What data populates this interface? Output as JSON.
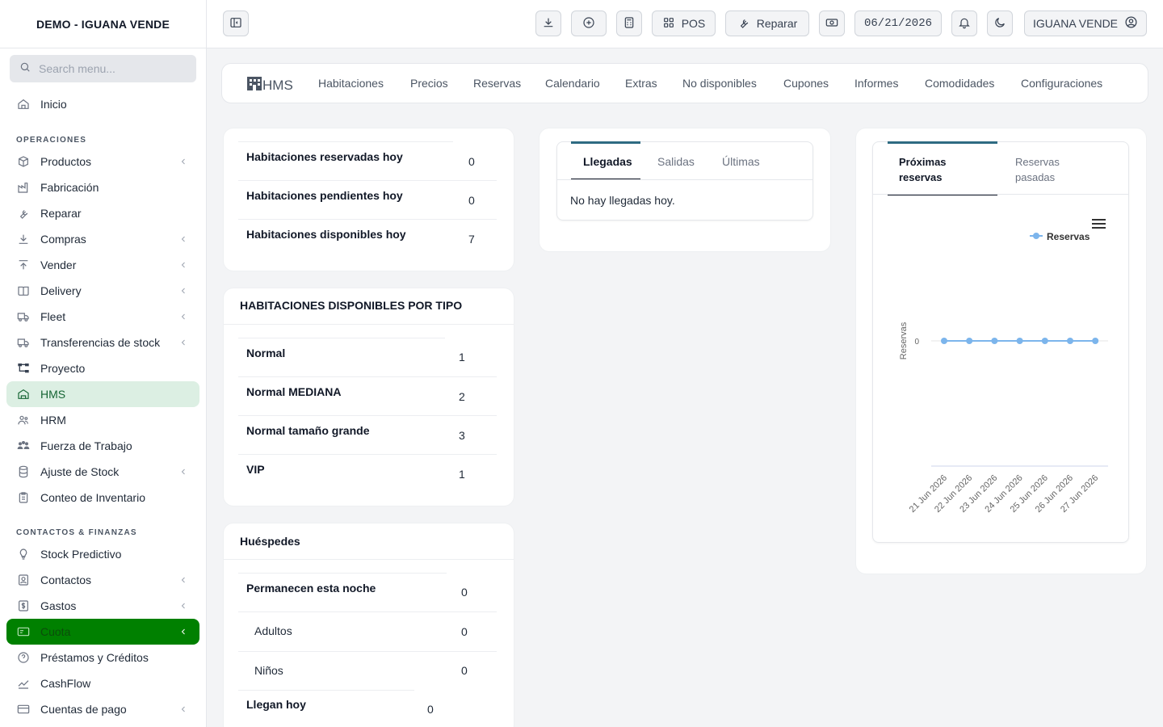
{
  "sidebar": {
    "brand": "DEMO - IGUANA VENDE",
    "search_placeholder": "Search menu...",
    "home": "Inicio",
    "section_ops": "OPERACIONES",
    "section_fin": "CONTACTOS & FINANZAS",
    "items": [
      {
        "label": "Productos"
      },
      {
        "label": "Fabricación"
      },
      {
        "label": "Reparar"
      },
      {
        "label": "Compras"
      },
      {
        "label": "Vender"
      },
      {
        "label": "Delivery"
      },
      {
        "label": "Fleet"
      },
      {
        "label": "Transferencias de stock"
      },
      {
        "label": "Proyecto"
      },
      {
        "label": "HMS"
      },
      {
        "label": "HRM"
      },
      {
        "label": "Fuerza de Trabajo"
      },
      {
        "label": "Ajuste de Stock"
      },
      {
        "label": "Conteo de Inventario"
      }
    ],
    "fin_items": [
      {
        "label": "Stock Predictivo"
      },
      {
        "label": "Contactos"
      },
      {
        "label": "Gastos"
      },
      {
        "label": "Cuota"
      },
      {
        "label": "Préstamos y Créditos"
      },
      {
        "label": "CashFlow"
      },
      {
        "label": "Cuentas de pago"
      }
    ]
  },
  "topbar": {
    "pos_label": "POS",
    "repair_label": "Reparar",
    "date": "06/21/2026",
    "user": "IGUANA VENDE"
  },
  "hms_nav": {
    "logo": "HMS",
    "links": [
      "Habitaciones",
      "Precios",
      "Reservas",
      "Calendario",
      "Extras",
      "No disponibles",
      "Cupones",
      "Informes",
      "Comodidades",
      "Configuraciones"
    ]
  },
  "summary": {
    "rows": [
      {
        "label": "Habitaciones reservadas hoy",
        "value": "0"
      },
      {
        "label": "Habitaciones pendientes hoy",
        "value": "0"
      },
      {
        "label": "Habitaciones disponibles hoy",
        "value": "7"
      }
    ]
  },
  "by_type": {
    "title": "HABITACIONES DISPONIBLES POR TIPO",
    "rows": [
      {
        "label": "Normal",
        "value": "1"
      },
      {
        "label": "Normal MEDIANA",
        "value": "2"
      },
      {
        "label": "Normal tamaño grande",
        "value": "3"
      },
      {
        "label": "VIP",
        "value": "1"
      }
    ]
  },
  "guests": {
    "title": "Huéspedes",
    "stay_label": "Permanecen esta noche",
    "stay_value": "0",
    "adults_label": "Adultos",
    "adults_value": "0",
    "kids_label": "Niños",
    "kids_value": "0",
    "arrive_label": "Llegan hoy",
    "arrive_value": "0"
  },
  "arrivals": {
    "tabs": [
      "Llegadas",
      "Salidas",
      "Últimas"
    ],
    "empty": "No hay llegadas hoy."
  },
  "bookings": {
    "tab_next": "Próximas reservas",
    "tab_past": "Reservas pasadas"
  },
  "chart_data": {
    "type": "line",
    "categories": [
      "21 Jun 2026",
      "22 Jun 2026",
      "23 Jun 2026",
      "24 Jun 2026",
      "25 Jun 2026",
      "26 Jun 2026",
      "27 Jun 2026"
    ],
    "series": [
      {
        "name": "Reservas",
        "values": [
          0,
          0,
          0,
          0,
          0,
          0,
          0
        ],
        "color": "#7cb5ec"
      }
    ],
    "ylabel": "Reservas",
    "yticks": [
      "0"
    ],
    "legend": "top-right"
  }
}
